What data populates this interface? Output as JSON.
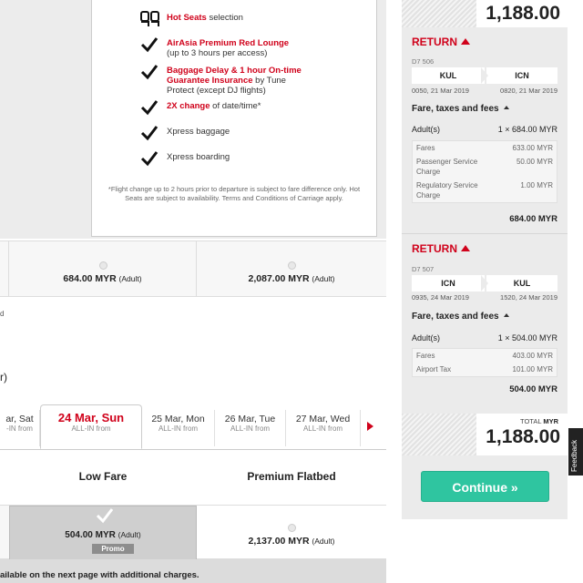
{
  "perks": [
    {
      "red": "Hot Seats",
      "rest": " selection",
      "icon": "seat-icon"
    },
    {
      "red": "AirAsia Premium Red Lounge",
      "rest": "(up to 3 hours per access)",
      "icon": "check-icon"
    },
    {
      "red": "Baggage Delay & 1 hour On-time Guarantee Insurance",
      "rest": " by Tune Protect (except DJ flights)",
      "icon": "check-icon"
    },
    {
      "red": "2X change",
      "rest": " of date/time*",
      "icon": "check-icon"
    },
    {
      "red": "",
      "rest": "Xpress baggage",
      "icon": "check-icon"
    },
    {
      "red": "",
      "rest": "Xpress boarding",
      "icon": "check-icon"
    }
  ],
  "fine_print": "*Flight change up to 2 hours prior to departure is subject to fare difference only. Hot Seats are subject to availability. Terms and Conditions of Carriage apply.",
  "depart_fares": [
    {
      "price": "684.00 MYR",
      "unit": "(Adult)"
    },
    {
      "price": "2,087.00 MYR",
      "unit": "(Adult)"
    }
  ],
  "cut_texts": {
    "a": "d",
    "b": "r)"
  },
  "dates": [
    {
      "label": "ar, Sat",
      "sub": "-IN from"
    },
    {
      "label": "24 Mar, Sun",
      "sub": "ALL-IN from"
    },
    {
      "label": "25 Mar, Mon",
      "sub": "ALL-IN from"
    },
    {
      "label": "26 Mar, Tue",
      "sub": "ALL-IN from"
    },
    {
      "label": "27 Mar, Wed",
      "sub": "ALL-IN from"
    }
  ],
  "columns": {
    "low": "Low Fare",
    "premium": "Premium Flatbed"
  },
  "return_fares": [
    {
      "price": "504.00 MYR",
      "unit": "(Adult)",
      "badge": "Promo"
    },
    {
      "price": "2,137.00 MYR",
      "unit": "(Adult)"
    }
  ],
  "bottom_note": "ailable on the next page with additional charges.",
  "summary": {
    "top_total": "1,188.00",
    "flights": [
      {
        "heading": "RETURN",
        "flight_no": "D7 506",
        "from": "KUL",
        "to": "ICN",
        "dep": "0050, 21 Mar 2019",
        "arr": "0820, 21 Mar 2019",
        "fare_title": "Fare, taxes and fees",
        "pax_label": "Adult(s)",
        "pax_value": "1 × 684.00 MYR",
        "breakdown": [
          {
            "label": "Fares",
            "value": "633.00 MYR"
          },
          {
            "label": "Passenger Service Charge",
            "value": "50.00 MYR"
          },
          {
            "label": "Regulatory Service Charge",
            "value": "1.00 MYR"
          }
        ],
        "subtotal": "684.00 MYR"
      },
      {
        "heading": "RETURN",
        "flight_no": "D7 507",
        "from": "ICN",
        "to": "KUL",
        "dep": "0935, 24 Mar 2019",
        "arr": "1520, 24 Mar 2019",
        "fare_title": "Fare, taxes and fees",
        "pax_label": "Adult(s)",
        "pax_value": "1 × 504.00 MYR",
        "breakdown": [
          {
            "label": "Fares",
            "value": "403.00 MYR"
          },
          {
            "label": "Airport Tax",
            "value": "101.00 MYR"
          }
        ],
        "subtotal": "504.00 MYR"
      }
    ],
    "total_label": "TOTAL",
    "total_currency": "MYR",
    "total_amount": "1,188.00",
    "continue_label": "Continue »"
  },
  "feedback_label": "Feedback",
  "colors": {
    "accent_red": "#d0021b",
    "continue_green": "#2fc5a0"
  }
}
